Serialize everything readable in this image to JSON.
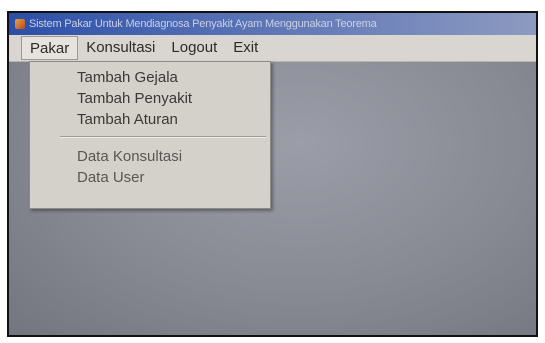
{
  "window": {
    "title": "Sistem Pakar Untuk Mendiagnosa Penyakit Ayam Menggunakan Teorema"
  },
  "menubar": {
    "items": [
      {
        "label": "Pakar"
      },
      {
        "label": "Konsultasi"
      },
      {
        "label": "Logout"
      },
      {
        "label": "Exit"
      }
    ]
  },
  "dropdown": {
    "group1": [
      {
        "label": "Tambah Gejala"
      },
      {
        "label": "Tambah Penyakit"
      },
      {
        "label": "Tambah Aturan"
      }
    ],
    "group2": [
      {
        "label": "Data Konsultasi"
      },
      {
        "label": "Data User"
      }
    ]
  },
  "colors": {
    "titlebar_start": "#2b4fa8",
    "menubar_bg": "#d9d6d1",
    "client_bg": "#878993"
  }
}
